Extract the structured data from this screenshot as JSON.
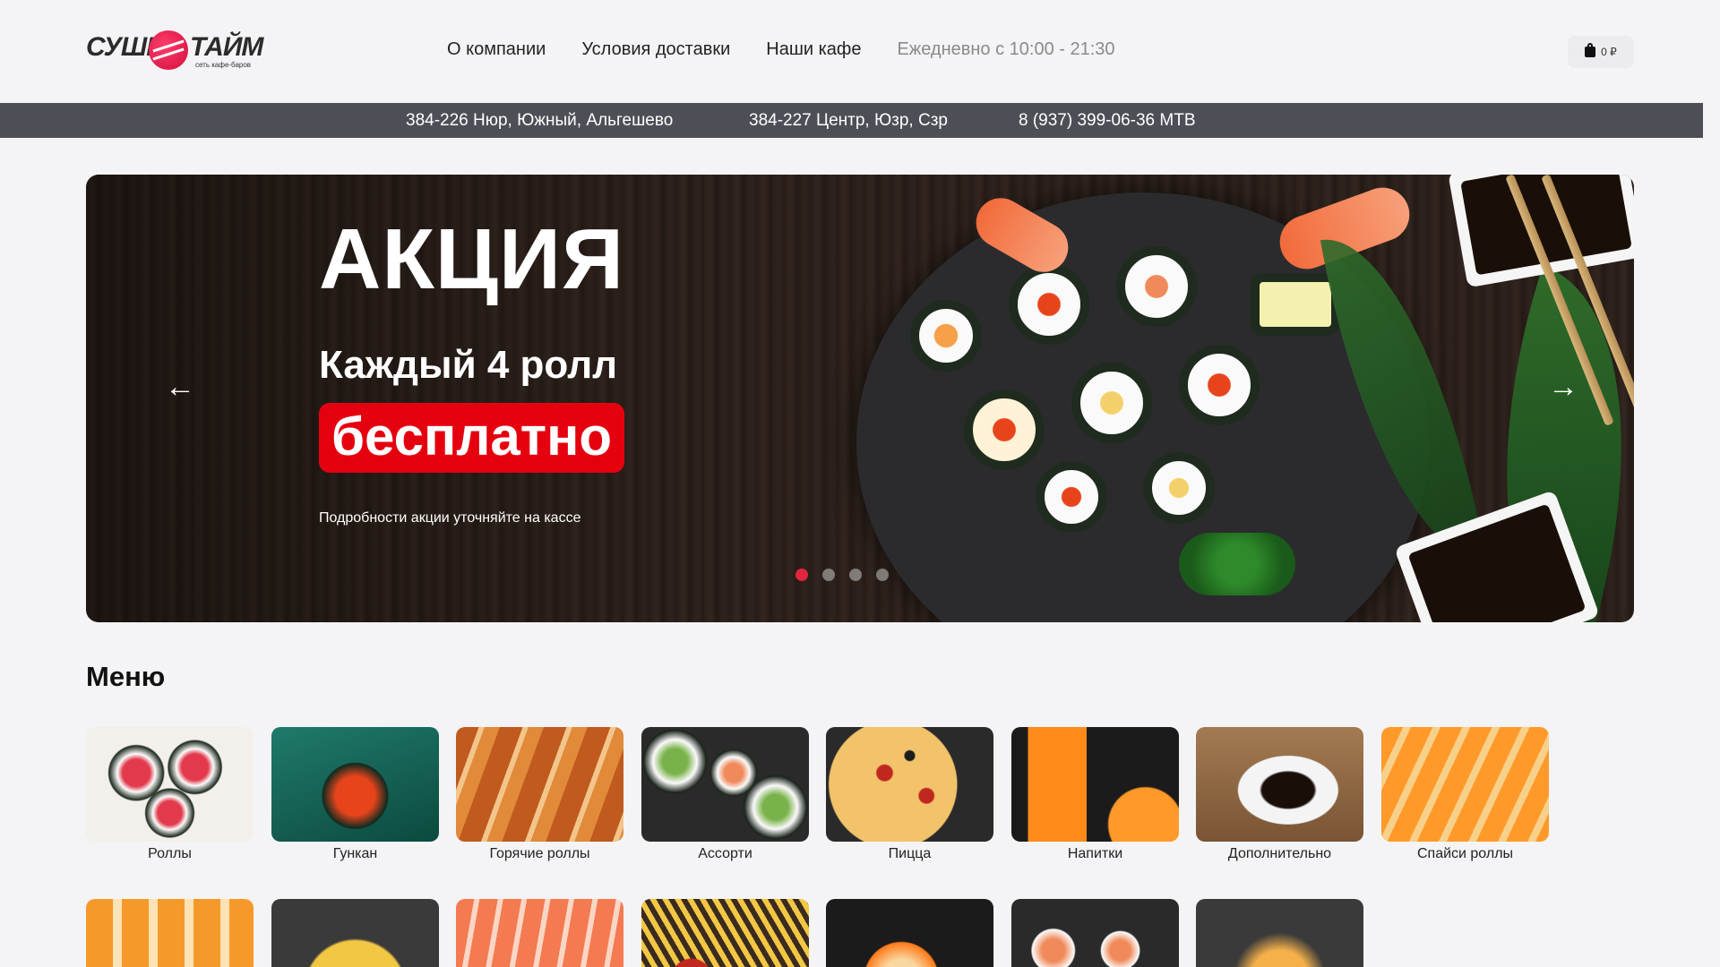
{
  "header": {
    "logo": {
      "left": "СУШИ",
      "right": "ТАЙМ",
      "sub": "сеть кафе-баров"
    },
    "nav": [
      {
        "label": "О компании"
      },
      {
        "label": "Условия доставки"
      },
      {
        "label": "Наши кафе"
      }
    ],
    "hours": "Ежедневно с 10:00 - 21:30",
    "cart": {
      "icon": "bag-icon",
      "total": "0 ₽"
    }
  },
  "strip": {
    "address1": "384-226 Нюр, Южный, Альгешево",
    "address2": "384-227 Центр, Юзр, Сзр",
    "phone": "8 (937) 399-06-36 МТВ"
  },
  "hero": {
    "title": "АКЦИЯ",
    "subtitle": "Каждый 4 ролл",
    "badge": "бесплатно",
    "note": "Подробности акции уточняйте на кассе",
    "prev_icon": "arrow-left-icon",
    "next_icon": "arrow-right-icon",
    "slides": 4,
    "active_slide": 1,
    "accent": "#e5000f"
  },
  "menu": {
    "title": "Меню",
    "items": [
      {
        "label": "Роллы"
      },
      {
        "label": "Гункан"
      },
      {
        "label": "Горячие роллы"
      },
      {
        "label": "Ассорти"
      },
      {
        "label": "Пицца"
      },
      {
        "label": "Напитки"
      },
      {
        "label": "Дополнительно"
      },
      {
        "label": "Спайси роллы"
      }
    ],
    "row2_count": 7
  }
}
